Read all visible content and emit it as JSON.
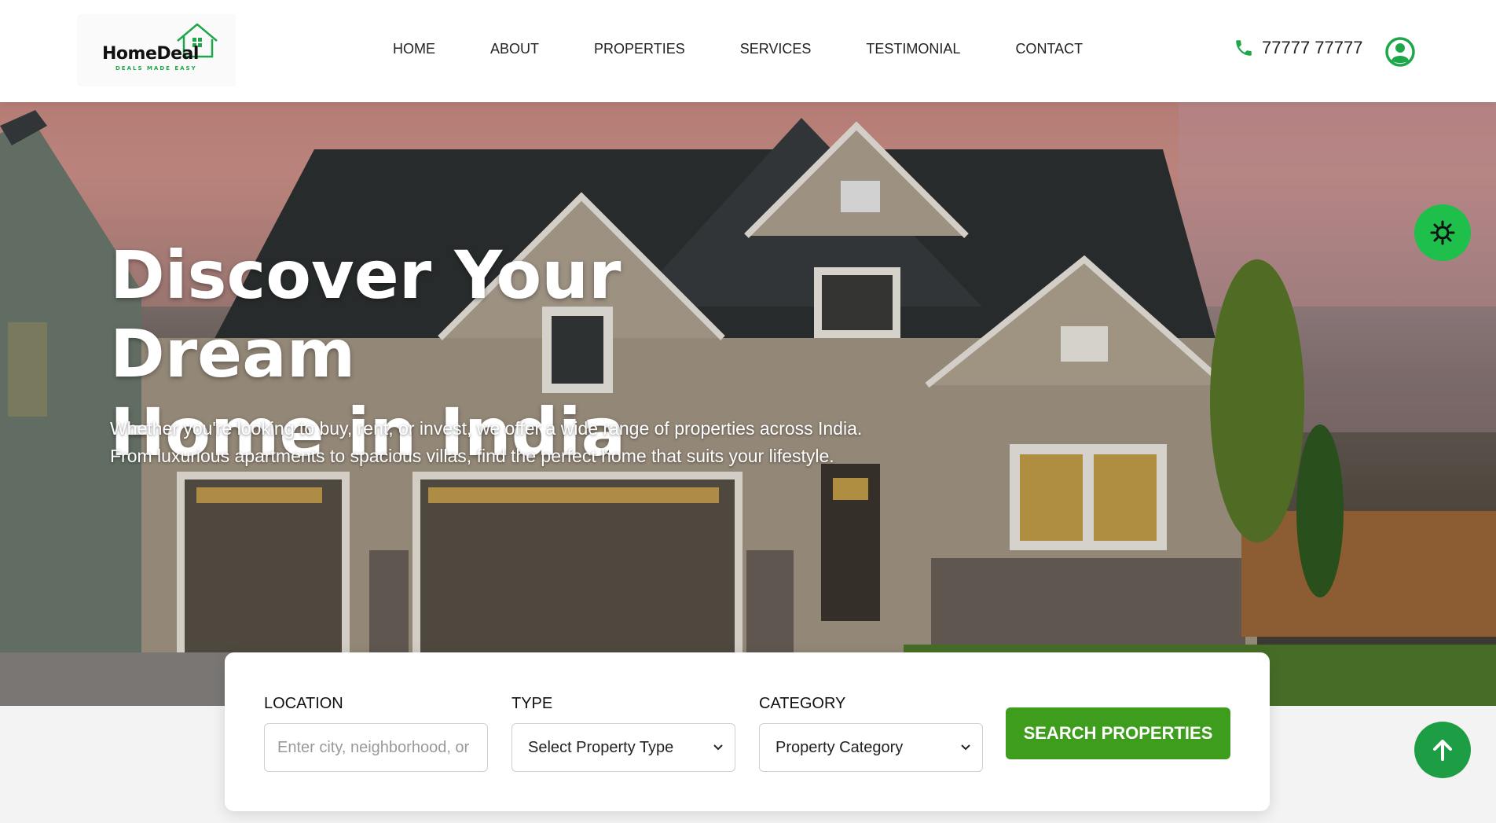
{
  "brand": {
    "name": "HomeDeal",
    "tagline": "DEALS MADE EASY",
    "accent_color": "#1fbf4b",
    "button_color": "#3f9d1d"
  },
  "nav": {
    "items": [
      {
        "label": "HOME"
      },
      {
        "label": "ABOUT"
      },
      {
        "label": "PROPERTIES"
      },
      {
        "label": "SERVICES"
      },
      {
        "label": "TESTIMONIAL"
      },
      {
        "label": "CONTACT"
      }
    ]
  },
  "contact": {
    "phone": "77777 77777",
    "phone_icon": "phone-icon",
    "user_icon": "user-circle-icon"
  },
  "hero": {
    "title_line1": "Discover Your Dream",
    "title_line2": "Home in India",
    "subtitle": "Whether you're looking to buy, rent, or invest, we offer a wide range of properties across India. From luxurious apartments to spacious villas, find the perfect home that suits your lifestyle."
  },
  "search": {
    "location_label": "LOCATION",
    "location_placeholder": "Enter city, neighborhood, or",
    "type_label": "TYPE",
    "type_value": "Select Property Type",
    "category_label": "CATEGORY",
    "category_value": "Property Category",
    "button_label": "SEARCH PROPERTIES"
  },
  "floating": {
    "theme_icon": "sun-icon",
    "scroll_top_icon": "arrow-up-icon"
  }
}
